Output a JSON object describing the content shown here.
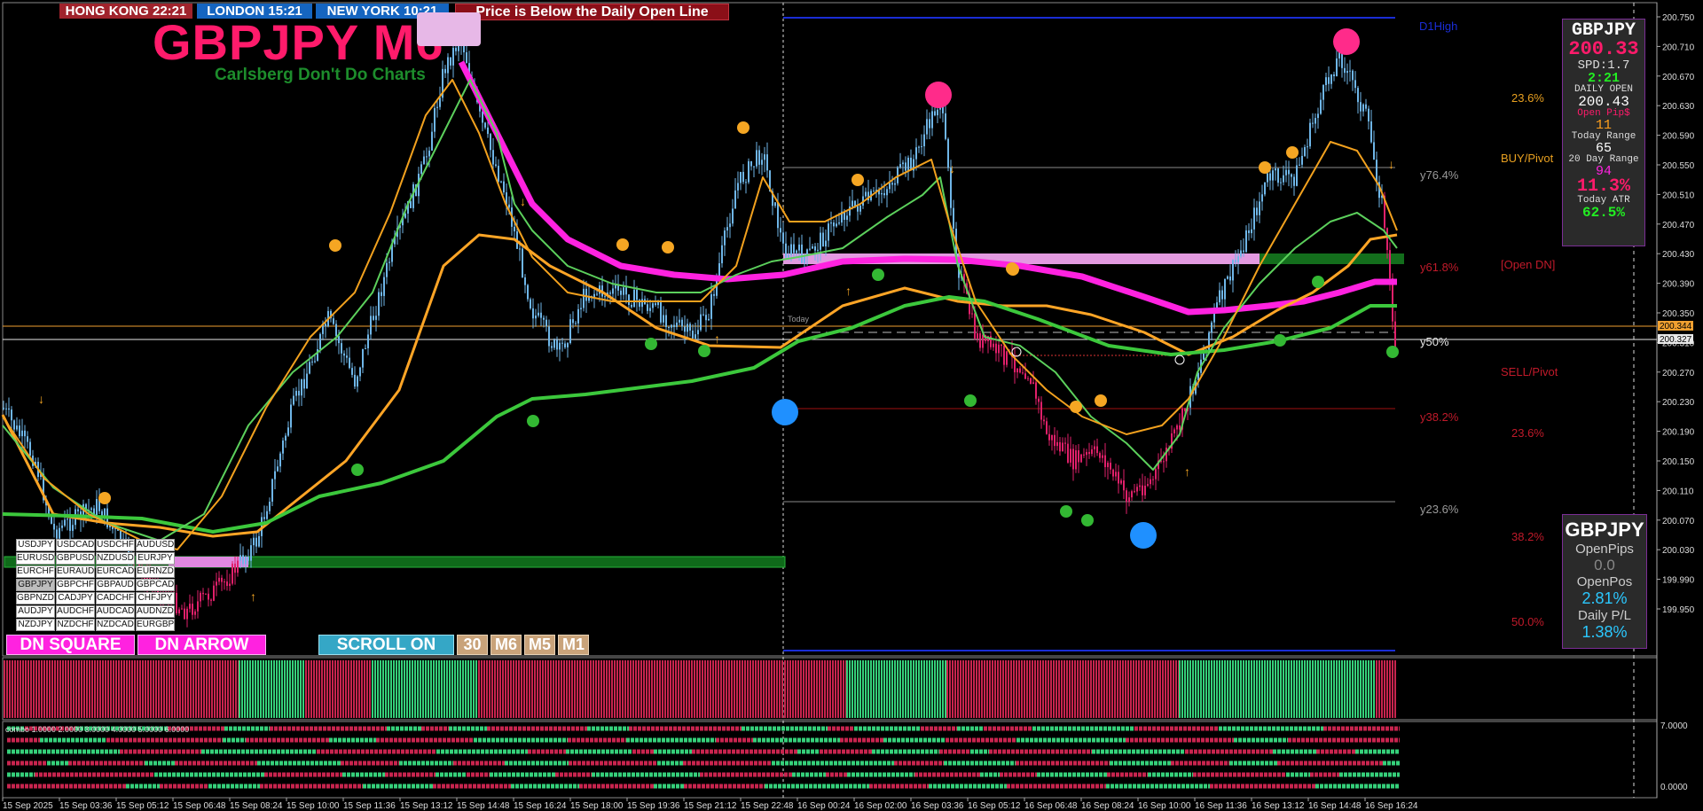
{
  "clocks": [
    {
      "label": "HONG KONG 22:21",
      "color": "#a0232c"
    },
    {
      "label": "LONDON  15:21",
      "color": "#1565c0"
    },
    {
      "label": "NEW YORK  10:21",
      "color": "#1565c0"
    }
  ],
  "alert_banner": "Price is Below the Daily Open Line",
  "chart_title": "GBPJPY M6",
  "chart_subtitle": "Carlsberg Don't Do Charts",
  "pairs": [
    "USDJPY",
    "USDCAD",
    "USDCHF",
    "AUDUSD",
    "EURUSD",
    "GBPUSD",
    "NZDUSD",
    "EURJPY",
    "EURCHF",
    "EURAUD",
    "EURCAD",
    "EURNZD",
    "GBPJPY",
    "GBPCHF",
    "GBPAUD",
    "GBPCAD",
    "GBPNZD",
    "CADJPY",
    "CADCHF",
    "CHFJPY",
    "AUDJPY",
    "AUDCHF",
    "AUDCAD",
    "AUDNZD",
    "NZDJPY",
    "NZDCHF",
    "NZDCAD",
    "EURGBP"
  ],
  "active_pair": "GBPJPY",
  "buttons": {
    "dn_square": "DN SQUARE",
    "dn_arrow": "DN ARROW",
    "scroll": "SCROLL ON"
  },
  "timeframes": [
    "30",
    "M6",
    "M5",
    "M1"
  ],
  "price_axis": [
    "200.750",
    "200.710",
    "200.670",
    "200.630",
    "200.590",
    "200.550",
    "200.510",
    "200.470",
    "200.430",
    "200.390",
    "200.350",
    "200.310",
    "200.270",
    "200.230",
    "200.190",
    "200.150",
    "200.110",
    "200.070",
    "200.030",
    "199.990",
    "199.950"
  ],
  "price_tags": {
    "orange": "200.344",
    "white": "200.327"
  },
  "time_axis": [
    "15 Sep 2025",
    "15 Sep 03:36",
    "15 Sep 05:12",
    "15 Sep 06:48",
    "15 Sep 08:24",
    "15 Sep 10:00",
    "15 Sep 11:36",
    "15 Sep 13:12",
    "15 Sep 14:48",
    "15 Sep 16:24",
    "15 Sep 18:00",
    "15 Sep 19:36",
    "15 Sep 21:12",
    "15 Sep 22:48",
    "16 Sep 00:24",
    "16 Sep 02:00",
    "16 Sep 03:36",
    "16 Sep 05:12",
    "16 Sep 06:48",
    "16 Sep 08:24",
    "16 Sep 10:00",
    "16 Sep 11:36",
    "16 Sep 13:12",
    "16 Sep 14:48",
    "16 Sep 16:24"
  ],
  "levels": {
    "d1high": "D1High",
    "y76": "y76.4%",
    "y61": "y61.8%",
    "y50": "y50%",
    "y38": "y38.2%",
    "y23": "y23.6%",
    "buy_pivot": "BUY/Pivot",
    "open_dn": "[Open DN]",
    "sell_pivot": "SELL/Pivot",
    "fib_up": "23.6%",
    "fib_dn1": "23.6%",
    "fib_dn2": "38.2%",
    "fib_dn3": "50.0%",
    "today": "Today"
  },
  "info": {
    "symbol": "GBPJPY",
    "price": "200.33",
    "spread": "SPD:1.7",
    "timer": "2:21",
    "daily_open_label": "DAILY OPEN",
    "daily_open": "200.43",
    "open_pips_label": "Open Pip$",
    "open_pips": "11",
    "today_range_label": "Today Range",
    "today_range": "65",
    "range20_label": "20 Day Range",
    "range20": "94",
    "atr_pct": "11.3%",
    "today_atr_label": "Today ATR",
    "today_atr": "62.5%"
  },
  "pip_panel": {
    "symbol": "GBPJPY",
    "open_pips_label": "OpenPips",
    "open_pips": "0.0",
    "open_pos_label": "OpenPos",
    "open_pos": "2.81%",
    "daily_pl_label": "Daily P/L",
    "daily_pl": "1.38%"
  },
  "sub2": {
    "legend": "combo  1.0000  2.0000  3.0000  4.0000  5.0000  6.0000",
    "max": "7.0000",
    "min": "0.0000"
  },
  "colors": {
    "bull": "#35d07a",
    "bear": "#c8244e",
    "up_candle": "#6fb6e8",
    "dn_candle": "#e0206a",
    "magenta": "#ff22e0",
    "orange": "#ffa526",
    "green": "#3cc83c"
  }
}
